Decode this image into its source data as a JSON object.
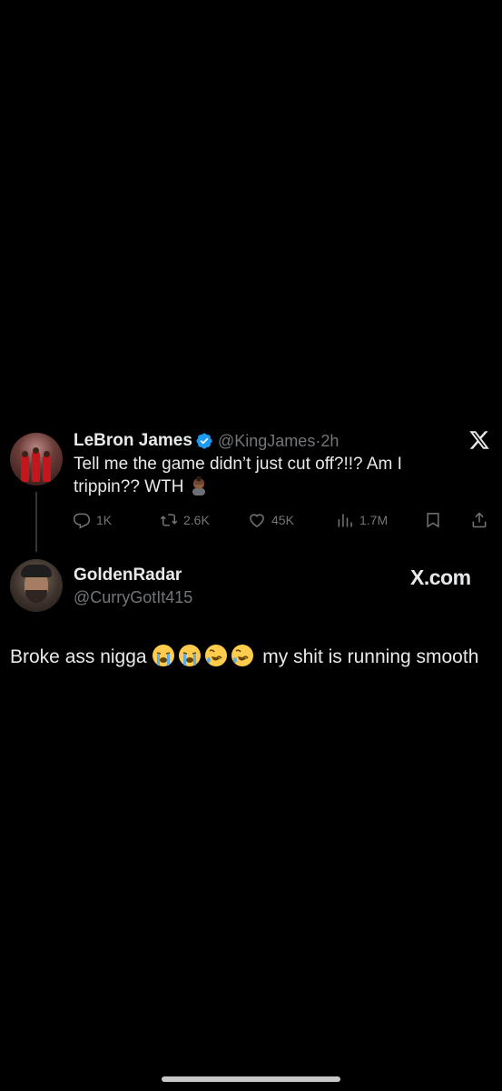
{
  "original_tweet": {
    "author_name": "LeBron James",
    "handle": "@KingJames",
    "separator": "·",
    "time": "2h",
    "text": "Tell me the game didn’t just cut off?!!? Am I trippin?? WTH",
    "verified_color": "#1d9bf0",
    "emoji": "man-facepalming-emoji",
    "stats": {
      "replies": "1K",
      "reposts": "2.6K",
      "likes": "45K",
      "views": "1.7M"
    }
  },
  "reply": {
    "author_name": "GoldenRadar",
    "handle": "@CurryGotIt415",
    "brand": "X.com",
    "text_before": "Broke ass nigga",
    "text_after": "my shit is running smooth",
    "emojis": [
      "loudly-crying-face",
      "loudly-crying-face",
      "rolling-on-floor-laughing",
      "rolling-on-floor-laughing"
    ]
  },
  "colors": {
    "background": "#000000",
    "text_primary": "#e7e9ea",
    "text_secondary": "#71767b"
  }
}
